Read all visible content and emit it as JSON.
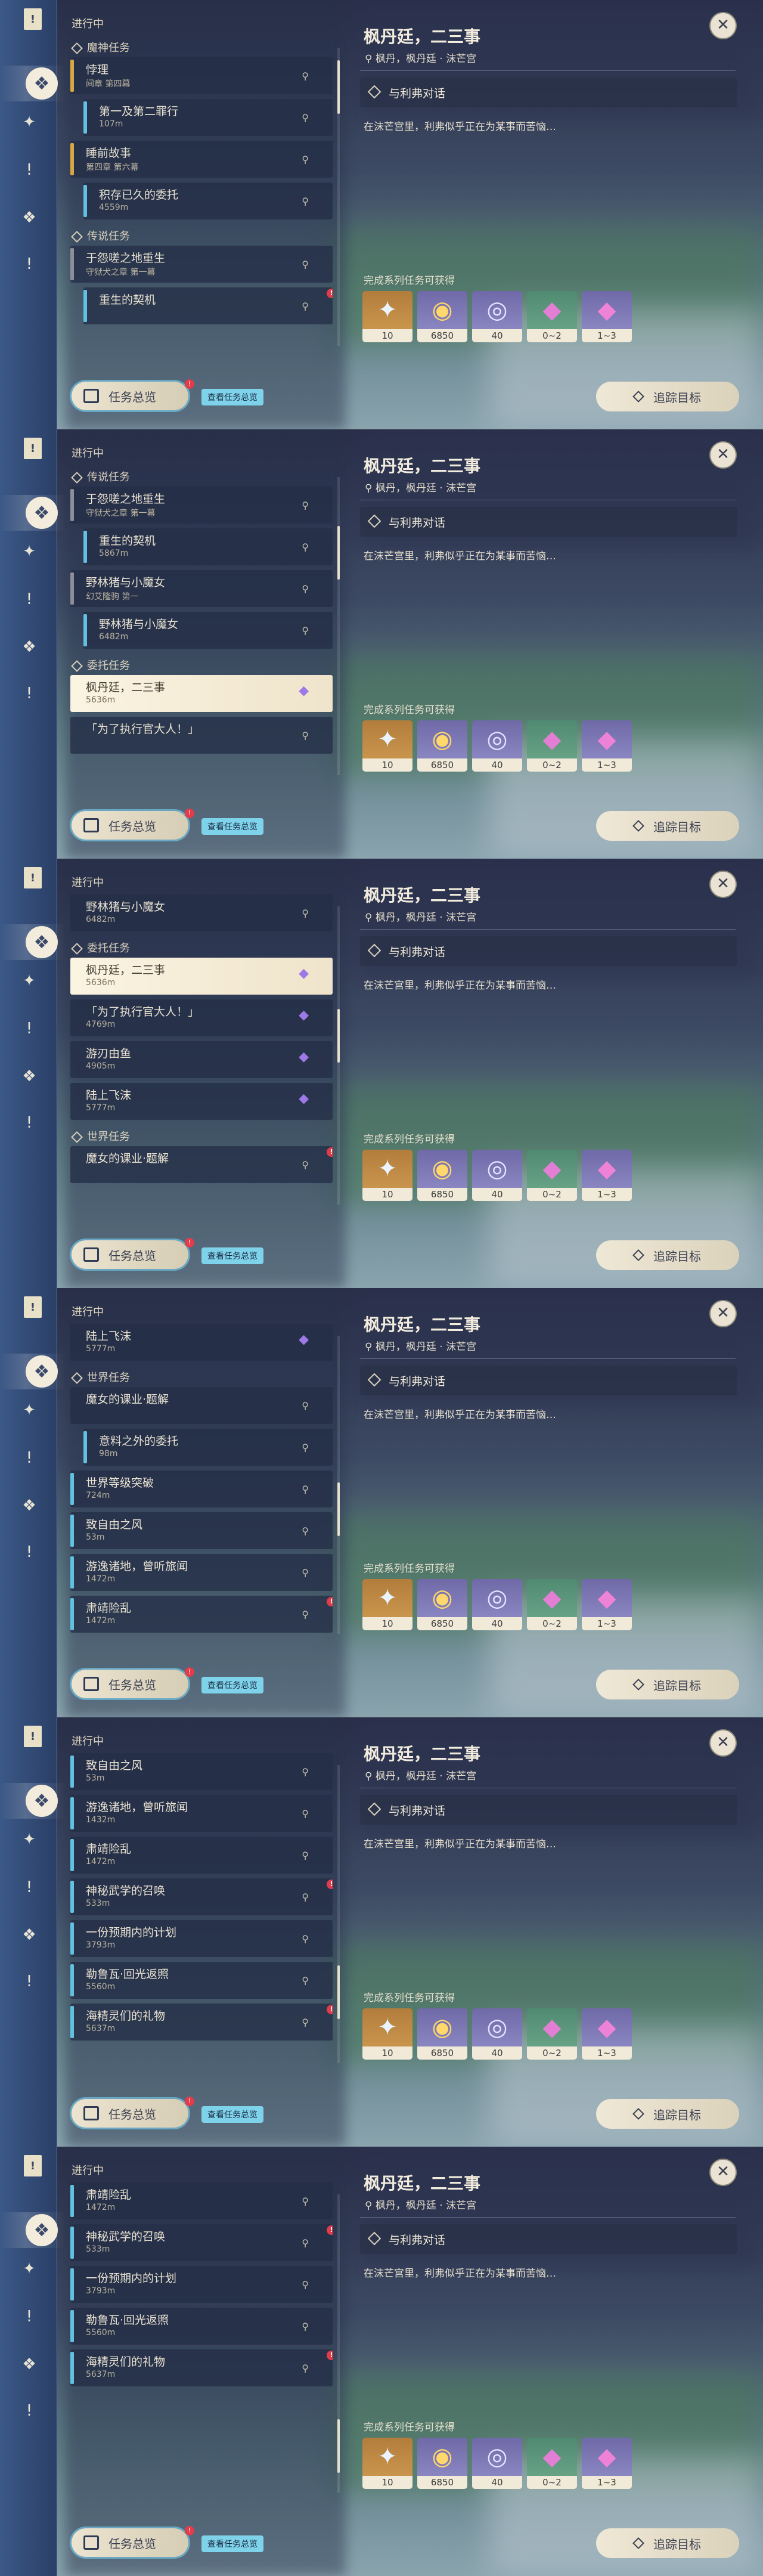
{
  "ui": {
    "in_progress": "进行中",
    "overview_label": "任务总览",
    "view_all": "查看任务总览",
    "track_label": "追踪目标",
    "close": "✕",
    "badge": "!"
  },
  "detail": {
    "title": "枫丹廷，二三事",
    "location": "枫丹，枫丹廷 · 沫芒宫",
    "objective": "与利弗对话",
    "description": "在沫芒宫里，利弗似乎正在为某事而苦恼…",
    "rewards_header": "完成系列任务可获得",
    "rewards": [
      {
        "icon": "primogem-icon",
        "count": "10"
      },
      {
        "icon": "mora-icon",
        "count": "6850"
      },
      {
        "icon": "adventure-exp-icon",
        "count": "40"
      },
      {
        "icon": "crystal-ore-icon",
        "count": "0~2"
      },
      {
        "icon": "crystal-chunk-icon",
        "count": "1~3"
      }
    ]
  },
  "panels": [
    {
      "items": [
        {
          "kind": "section",
          "text": "魔神任务"
        },
        {
          "kind": "quest",
          "title": "悖理",
          "desc": "间章 第四幕",
          "accent": "gold"
        },
        {
          "kind": "sub",
          "title": "第一及第二罪行",
          "desc": "107m"
        },
        {
          "kind": "quest",
          "title": "睡前故事",
          "desc": "第四章 第六幕",
          "accent": "gold"
        },
        {
          "kind": "sub",
          "title": "积存已久的委托",
          "desc": "4559m"
        },
        {
          "kind": "section",
          "text": "传说任务"
        },
        {
          "kind": "quest",
          "title": "于怨嗟之地重生",
          "desc": "守狱犬之章 第一幕",
          "accent": "gray"
        },
        {
          "kind": "sub",
          "title": "重生的契机",
          "desc": "",
          "badge": true
        }
      ],
      "thumb": 0.05
    },
    {
      "items": [
        {
          "kind": "section",
          "text": "传说任务"
        },
        {
          "kind": "quest",
          "title": "于怨嗟之地重生",
          "desc": "守狱犬之章 第一幕",
          "accent": "gray"
        },
        {
          "kind": "sub",
          "title": "重生的契机",
          "desc": "5867m"
        },
        {
          "kind": "quest",
          "title": "野林猪与小魔女",
          "desc": "幻艾隆驹 第一",
          "accent": "gray"
        },
        {
          "kind": "sub",
          "title": "野林猪与小魔女",
          "desc": "6482m"
        },
        {
          "kind": "section",
          "text": "委托任务"
        },
        {
          "kind": "sel",
          "title": "枫丹廷，二三事",
          "desc": "5636m"
        },
        {
          "kind": "quest",
          "title": "「为了执行官大人！」",
          "desc": "",
          "accent": "none"
        }
      ],
      "thumb": 0.2
    },
    {
      "items": [
        {
          "kind": "quest",
          "title": "野林猪与小魔女",
          "desc": "6482m",
          "accent": "none"
        },
        {
          "kind": "section",
          "text": "委托任务"
        },
        {
          "kind": "sel",
          "title": "枫丹廷，二三事",
          "desc": "5636m"
        },
        {
          "kind": "purple",
          "title": "「为了执行官大人！」",
          "desc": "4769m"
        },
        {
          "kind": "purple",
          "title": "游刃由鱼",
          "desc": "4905m"
        },
        {
          "kind": "purple",
          "title": "陆上飞沫",
          "desc": "5777m"
        },
        {
          "kind": "section",
          "text": "世界任务"
        },
        {
          "kind": "quest",
          "title": "魔女的课业·题解",
          "desc": "",
          "accent": "none",
          "badge": true
        }
      ],
      "thumb": 0.42
    },
    {
      "items": [
        {
          "kind": "purple",
          "title": "陆上飞沫",
          "desc": "5777m"
        },
        {
          "kind": "section",
          "text": "世界任务"
        },
        {
          "kind": "quest",
          "title": "魔女的课业·题解",
          "desc": "",
          "accent": "none"
        },
        {
          "kind": "sub",
          "title": "意料之外的委托",
          "desc": "98m"
        },
        {
          "kind": "blue",
          "title": "世界等级突破",
          "desc": "724m"
        },
        {
          "kind": "blue",
          "title": "致自由之风",
          "desc": "53m"
        },
        {
          "kind": "blue",
          "title": "游逸诸地，曾听旅闻",
          "desc": "1472m"
        },
        {
          "kind": "blue",
          "title": "肃靖险乱",
          "desc": "1472m",
          "badge": true
        }
      ],
      "thumb": 0.6
    },
    {
      "items": [
        {
          "kind": "blue",
          "title": "致自由之风",
          "desc": "53m"
        },
        {
          "kind": "blue",
          "title": "游逸诸地，曾听旅闻",
          "desc": "1432m"
        },
        {
          "kind": "blue",
          "title": "肃靖险乱",
          "desc": "1472m"
        },
        {
          "kind": "blue",
          "title": "神秘武学的召唤",
          "desc": "533m",
          "badge": true
        },
        {
          "kind": "blue",
          "title": "一份预期内的计划",
          "desc": "3793m"
        },
        {
          "kind": "blue",
          "title": "勒鲁瓦·回光返照",
          "desc": "5560m"
        },
        {
          "kind": "blue",
          "title": "海精灵们的礼物",
          "desc": "5637m",
          "badge": true
        }
      ],
      "thumb": 0.82
    },
    {
      "items": [
        {
          "kind": "blue",
          "title": "肃靖险乱",
          "desc": "1472m"
        },
        {
          "kind": "blue",
          "title": "神秘武学的召唤",
          "desc": "533m",
          "badge": true
        },
        {
          "kind": "blue",
          "title": "一份预期内的计划",
          "desc": "3793m"
        },
        {
          "kind": "blue",
          "title": "勒鲁瓦·回光返照",
          "desc": "5560m"
        },
        {
          "kind": "blue",
          "title": "海精灵们的礼物",
          "desc": "5637m",
          "badge": true
        }
      ],
      "thumb": 0.92
    }
  ]
}
